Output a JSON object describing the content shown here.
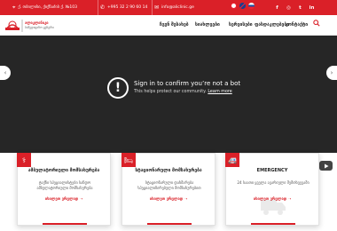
{
  "topbar": {
    "address": "ქ. თბილისი, ქიქნაძის ქ. №103",
    "phone": "+995 32 2 90 60 14",
    "email": "info@aliclinic.ge",
    "icons": {
      "location": "location-pin-icon",
      "phone": "phone-icon",
      "email": "envelope-icon"
    },
    "social": [
      {
        "name": "facebook-icon",
        "glyph": "f"
      },
      {
        "name": "instagram-icon",
        "glyph": "◎"
      },
      {
        "name": "twitter-icon",
        "glyph": "t"
      },
      {
        "name": "linkedin-icon",
        "glyph": "in"
      }
    ],
    "languages": [
      "georgian-flag-icon",
      "english-flag-icon",
      "russian-flag-icon"
    ]
  },
  "header": {
    "logo_text_line1": "ალიკლინიკი",
    "logo_text_line2": "სამედიცინო ცენტრი",
    "nav": [
      "ჩვენ შესახებ",
      "სიახლეები",
      "სერვისები",
      "ფასდაკლებები",
      "კონტაქტი"
    ],
    "search_icon": "search-icon"
  },
  "hero": {
    "left_arrow": "‹",
    "right_arrow": "›",
    "notice_icon": "!",
    "notice_title": "Sign in to confirm you’re not a bot",
    "notice_text": "This helps protect our community.",
    "notice_link": "Learn more"
  },
  "cards": [
    {
      "icon": "stethoscope-icon",
      "glyph": "⚕",
      "title": "ამბულატორიული მომსახურება",
      "body": "ტაქნი სპეციალისტები სანდო ამბულატორიული მომსახურება",
      "more": "იხილეთ ვრცლად ➝"
    },
    {
      "icon": "hospital-bed-icon",
      "glyph": "🛏",
      "title": "სტაციონარული მომსახურება",
      "body": "სტაციონარული დახმარება სპეციალიზირებული მომსახურებით",
      "more": "იხილეთ ვრცლად ➝"
    },
    {
      "icon": "ambulance-icon",
      "glyph": "🚑",
      "title": "EMERGENCY",
      "body": "24 საათი ყველა ავარიული შემთხვევაში",
      "more": "იხილეთ ვრცლად ➝"
    }
  ],
  "colors": {
    "brand": "#da2028",
    "hero_bg": "#262626"
  }
}
